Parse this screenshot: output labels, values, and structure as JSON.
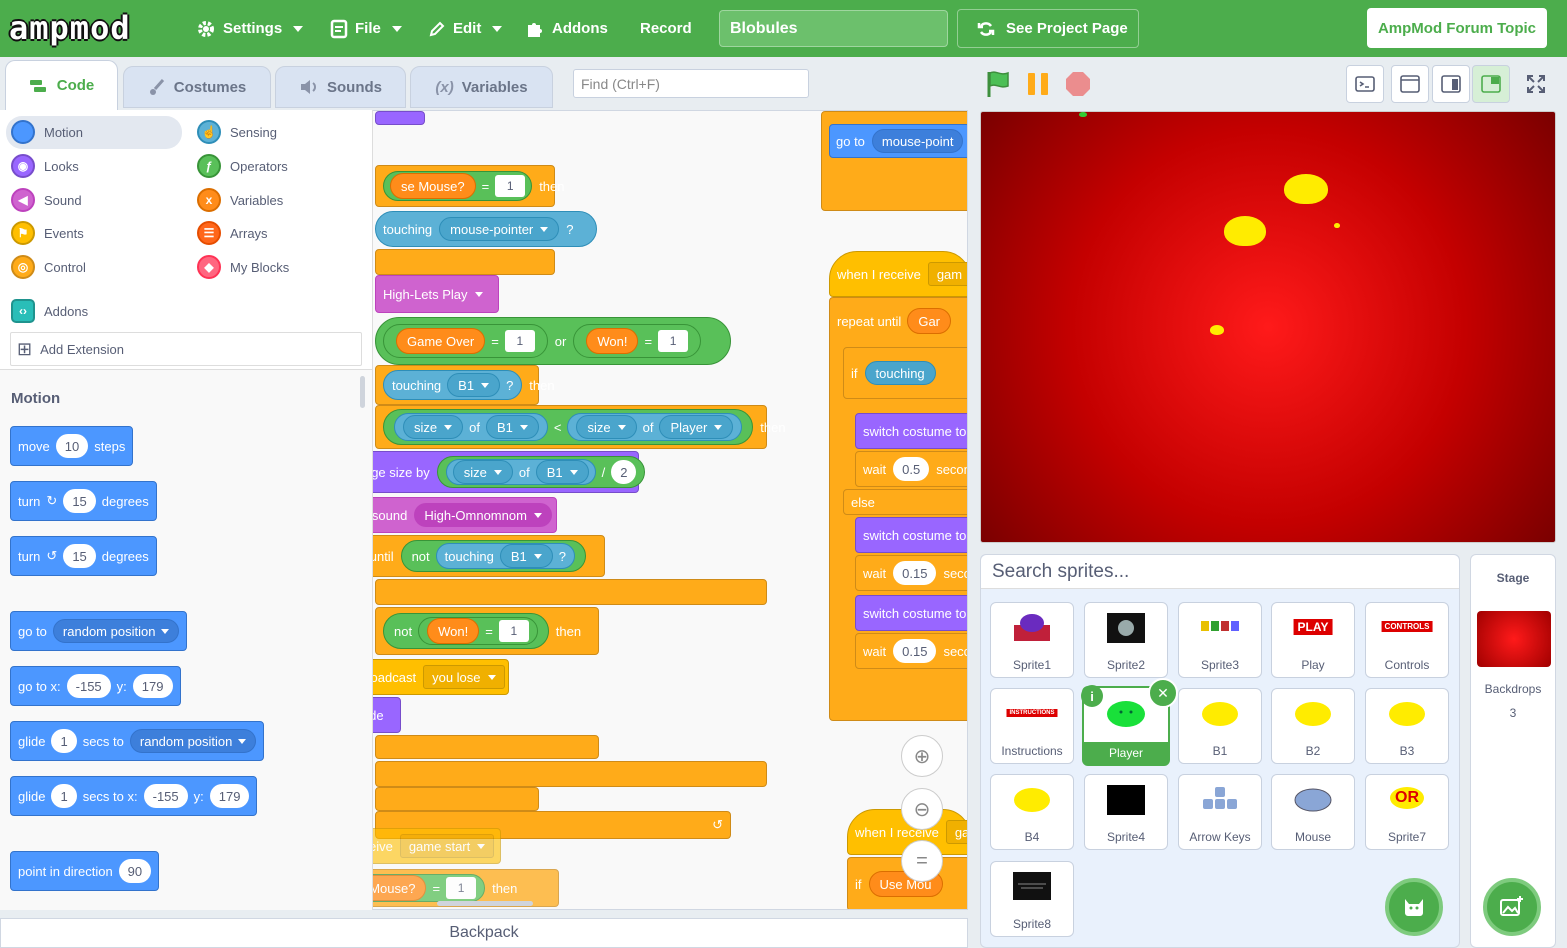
{
  "app": {
    "logo": "ampmod"
  },
  "menu": {
    "settings": "Settings",
    "file": "File",
    "edit": "Edit",
    "addons": "Addons",
    "record": "Record"
  },
  "project_title": "Blobules",
  "see_project": "See Project Page",
  "forum": "AmpMod Forum Topic",
  "tabs": {
    "code": "Code",
    "costumes": "Costumes",
    "sounds": "Sounds",
    "variables": "Variables"
  },
  "find_placeholder": "Find (Ctrl+F)",
  "categories": [
    {
      "label": "Motion",
      "color": "#4c97ff"
    },
    {
      "label": "Looks",
      "color": "#9966ff"
    },
    {
      "label": "Sound",
      "color": "#cf63cf"
    },
    {
      "label": "Events",
      "color": "#ffbf00"
    },
    {
      "label": "Control",
      "color": "#ffab19"
    },
    {
      "label": "Sensing",
      "color": "#5cb1d6"
    },
    {
      "label": "Operators",
      "color": "#59c059"
    },
    {
      "label": "Variables",
      "color": "#ff8c1a"
    },
    {
      "label": "Arrays",
      "color": "#ff661a"
    },
    {
      "label": "My Blocks",
      "color": "#ff6680"
    },
    {
      "label": "Addons",
      "color": "#29beb8"
    }
  ],
  "add_extension": "Add Extension",
  "palette": {
    "title": "Motion",
    "move": {
      "a": "move",
      "v": "10",
      "b": "steps"
    },
    "turn_r": {
      "a": "turn",
      "v": "15",
      "b": "degrees"
    },
    "turn_l": {
      "a": "turn",
      "v": "15",
      "b": "degrees"
    },
    "goto": {
      "a": "go to",
      "dd": "random position"
    },
    "gotoxy": {
      "a": "go to x:",
      "x": "-155",
      "b": "y:",
      "y": "179"
    },
    "glide": {
      "a": "glide",
      "v": "1",
      "b": "secs to",
      "dd": "random position"
    },
    "glidexy": {
      "a": "glide",
      "v": "1",
      "b": "secs to x:",
      "x": "-155",
      "c": "y:",
      "y": "179"
    },
    "point": {
      "a": "point in direction",
      "v": "90"
    }
  },
  "script": {
    "use_mouse": "se Mouse?",
    "eq": "=",
    "one": "1",
    "then": "then",
    "touching": "touching",
    "mouse_pointer": "mouse-pointer",
    "q": "?",
    "high_lets_play": "High-Lets Play",
    "game_over": "Game Over",
    "or": "or",
    "won": "Won!",
    "if": "if",
    "b1": "B1",
    "size": "size",
    "of": "of",
    "lt": "<",
    "player": "Player",
    "change_size_by": "change size by",
    "div": "/",
    "two": "2",
    "start_sound": "start sound",
    "omnomnom": "High-Omnomnom",
    "wait_until": "wait until",
    "not": "not",
    "else": "else",
    "broadcast": "broadcast",
    "you_lose": "you lose",
    "hide": "hide",
    "when_i_receive": "when I receive",
    "game_start": "game start",
    "use_mouse_full": "Use Mouse?",
    "go_to": "go to",
    "mouse_point": "mouse-point",
    "gam": "gam",
    "repeat_until": "repeat until",
    "gar": "Gar",
    "touchin": "touching",
    "switch_costume_to": "switch costume to",
    "wait": "wait",
    "w05": "0.5",
    "secon": "secon",
    "w015": "0.15",
    "secc": "secc",
    "ga": "ga",
    "use_mou": "Use Mou"
  },
  "sprites": {
    "search": "Search sprites...",
    "items": [
      "Sprite1",
      "Sprite2",
      "Sprite3",
      "Play",
      "Controls",
      "Instructions",
      "Player",
      "B1",
      "B2",
      "B3",
      "B4",
      "Sprite4",
      "Arrow Keys",
      "Mouse",
      "Sprite7",
      "Sprite8"
    ],
    "selected": "Player"
  },
  "thumbs": {
    "play": "PLAY",
    "controls": "CONTROLS",
    "instructions": "INSTRUCTIONS",
    "or": "OR"
  },
  "stage_pane": {
    "title": "Stage",
    "backdrops_label": "Backdrops",
    "backdrops_count": "3"
  },
  "backpack": "Backpack",
  "colors": {
    "menubar": "#4cad4c",
    "stage": "#e00000",
    "blob": "#ffec00"
  }
}
